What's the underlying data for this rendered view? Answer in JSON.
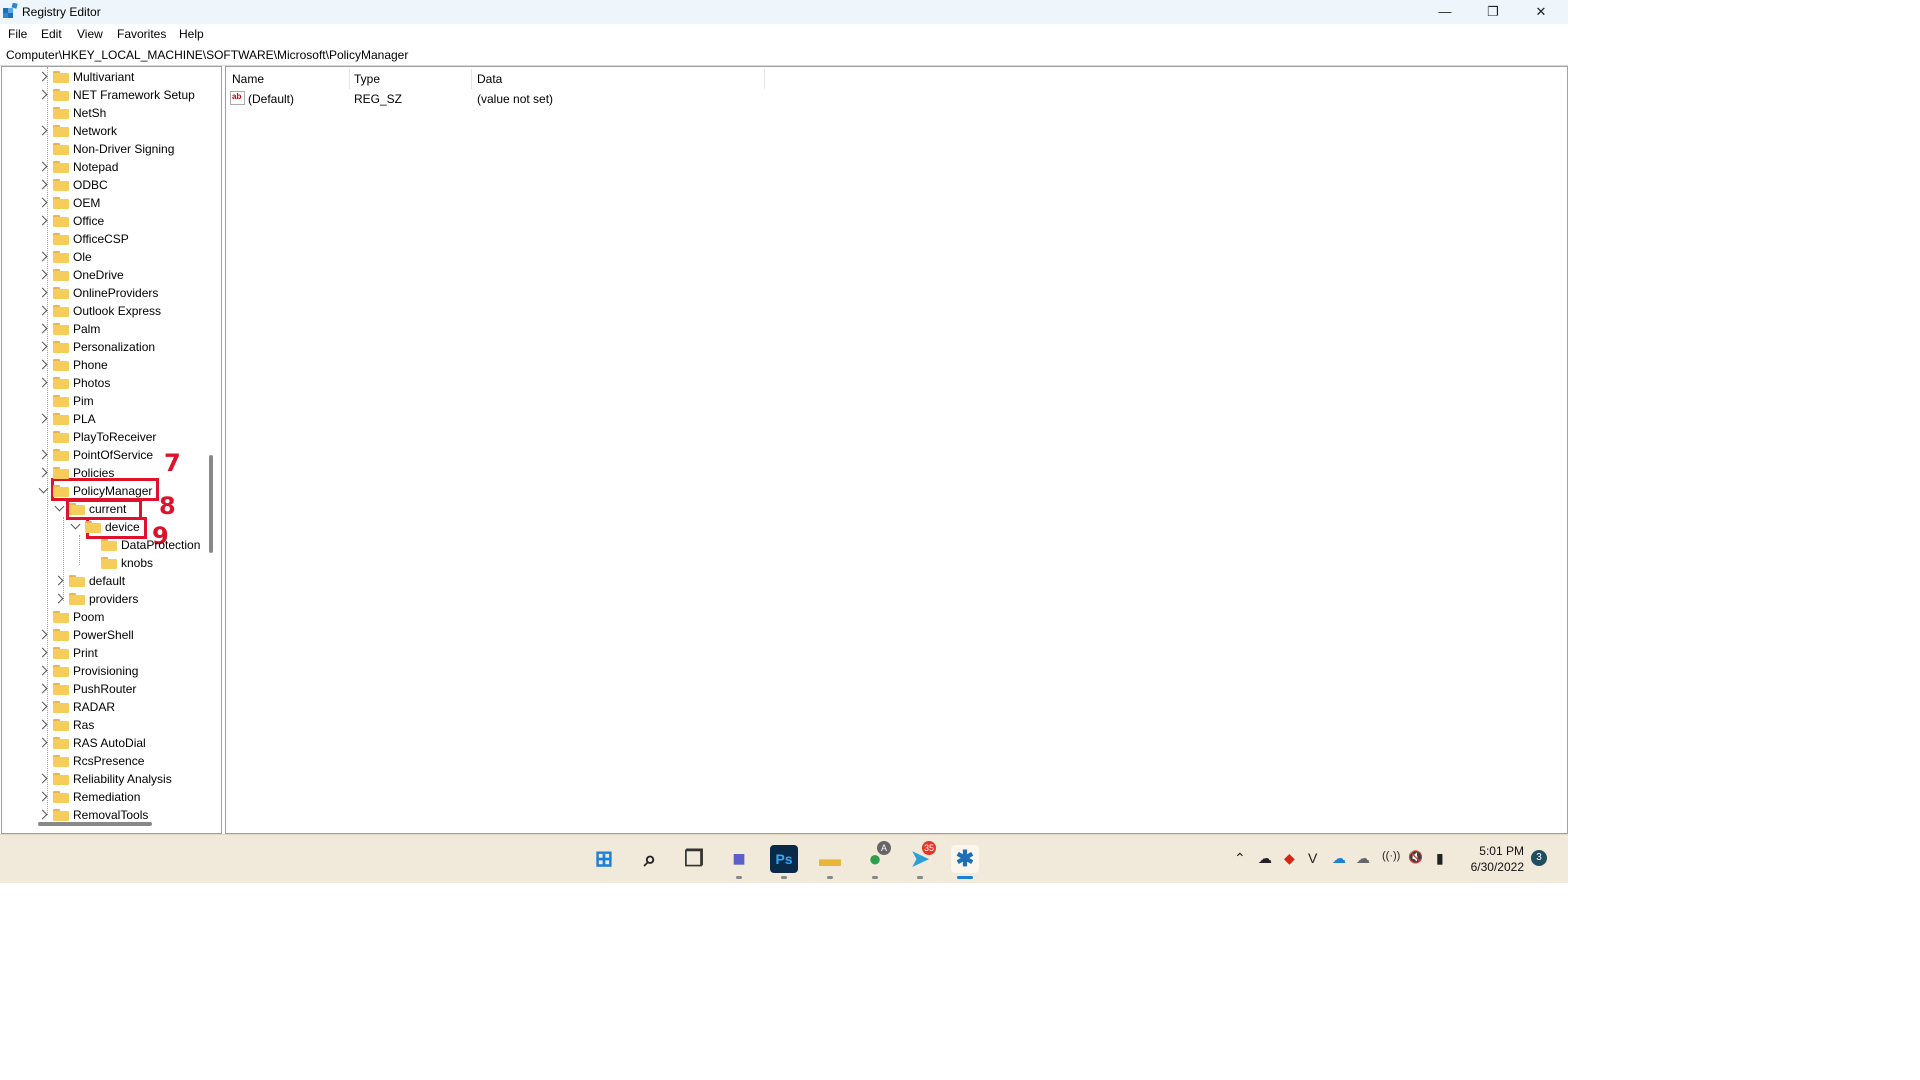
{
  "window": {
    "title": "Registry Editor",
    "controls": {
      "minimize": "—",
      "maximize": "❐",
      "close": "✕"
    }
  },
  "menu": [
    "File",
    "Edit",
    "View",
    "Favorites",
    "Help"
  ],
  "address": "Computer\\HKEY_LOCAL_MACHINE\\SOFTWARE\\Microsoft\\PolicyManager",
  "tree": {
    "items": [
      {
        "label": "Multivariant",
        "expander": "collapsed"
      },
      {
        "label": "NET Framework Setup",
        "expander": "collapsed"
      },
      {
        "label": "NetSh",
        "expander": "none"
      },
      {
        "label": "Network",
        "expander": "collapsed"
      },
      {
        "label": "Non-Driver Signing",
        "expander": "none"
      },
      {
        "label": "Notepad",
        "expander": "collapsed"
      },
      {
        "label": "ODBC",
        "expander": "collapsed"
      },
      {
        "label": "OEM",
        "expander": "collapsed"
      },
      {
        "label": "Office",
        "expander": "collapsed"
      },
      {
        "label": "OfficeCSP",
        "expander": "none"
      },
      {
        "label": "Ole",
        "expander": "collapsed"
      },
      {
        "label": "OneDrive",
        "expander": "collapsed"
      },
      {
        "label": "OnlineProviders",
        "expander": "collapsed"
      },
      {
        "label": "Outlook Express",
        "expander": "collapsed"
      },
      {
        "label": "Palm",
        "expander": "collapsed"
      },
      {
        "label": "Personalization",
        "expander": "collapsed"
      },
      {
        "label": "Phone",
        "expander": "collapsed"
      },
      {
        "label": "Photos",
        "expander": "collapsed"
      },
      {
        "label": "Pim",
        "expander": "none"
      },
      {
        "label": "PLA",
        "expander": "collapsed"
      },
      {
        "label": "PlayToReceiver",
        "expander": "none"
      },
      {
        "label": "PointOfService",
        "expander": "collapsed"
      },
      {
        "label": "Policies",
        "expander": "collapsed"
      },
      {
        "label": "PolicyManager",
        "expander": "expanded"
      },
      {
        "label": "current",
        "expander": "expanded"
      },
      {
        "label": "device",
        "expander": "expanded"
      },
      {
        "label": "DataProtection",
        "expander": "none"
      },
      {
        "label": "knobs",
        "expander": "none"
      },
      {
        "label": "default",
        "expander": "collapsed"
      },
      {
        "label": "providers",
        "expander": "collapsed"
      },
      {
        "label": "Poom",
        "expander": "none"
      },
      {
        "label": "PowerShell",
        "expander": "collapsed"
      },
      {
        "label": "Print",
        "expander": "collapsed"
      },
      {
        "label": "Provisioning",
        "expander": "collapsed"
      },
      {
        "label": "PushRouter",
        "expander": "collapsed"
      },
      {
        "label": "RADAR",
        "expander": "collapsed"
      },
      {
        "label": "Ras",
        "expander": "collapsed"
      },
      {
        "label": "RAS AutoDial",
        "expander": "collapsed"
      },
      {
        "label": "RcsPresence",
        "expander": "none"
      },
      {
        "label": "Reliability Analysis",
        "expander": "collapsed"
      },
      {
        "label": "Remediation",
        "expander": "collapsed"
      },
      {
        "label": "RemovalTools",
        "expander": "collapsed"
      }
    ]
  },
  "annotations": [
    "7",
    "8",
    "9"
  ],
  "values": {
    "columns": [
      "Name",
      "Type",
      "Data"
    ],
    "rows": [
      {
        "name": "(Default)",
        "type": "REG_SZ",
        "data": "(value not set)"
      }
    ]
  },
  "taskbar": {
    "apps": [
      {
        "name": "start",
        "glyph": "⊞",
        "color": "#1a7fd6"
      },
      {
        "name": "search",
        "glyph": "⌕",
        "color": "#222222"
      },
      {
        "name": "task-view",
        "glyph": "❐",
        "color": "#333333"
      },
      {
        "name": "chat",
        "glyph": "■",
        "color": "#5b5fc7"
      },
      {
        "name": "photoshop",
        "glyph": "Ps",
        "color": "#0a2a4a"
      },
      {
        "name": "file-explorer",
        "glyph": "▬",
        "color": "#e8b73a"
      },
      {
        "name": "chrome",
        "glyph": "●",
        "color": "#2e9e4f"
      },
      {
        "name": "telegram",
        "glyph": "➤",
        "color": "#2aa0da"
      },
      {
        "name": "registry-editor",
        "glyph": "✱",
        "color": "#1f6fb5"
      }
    ],
    "badges": {
      "telegram": "35",
      "chrome": "A"
    },
    "tray_icons": [
      "⌃",
      "☁",
      "◆",
      "V",
      "☁",
      "☁",
      "((·))",
      "🔇",
      "▮"
    ],
    "time": "5:01 PM",
    "date": "6/30/2022",
    "notification_count": "3"
  }
}
